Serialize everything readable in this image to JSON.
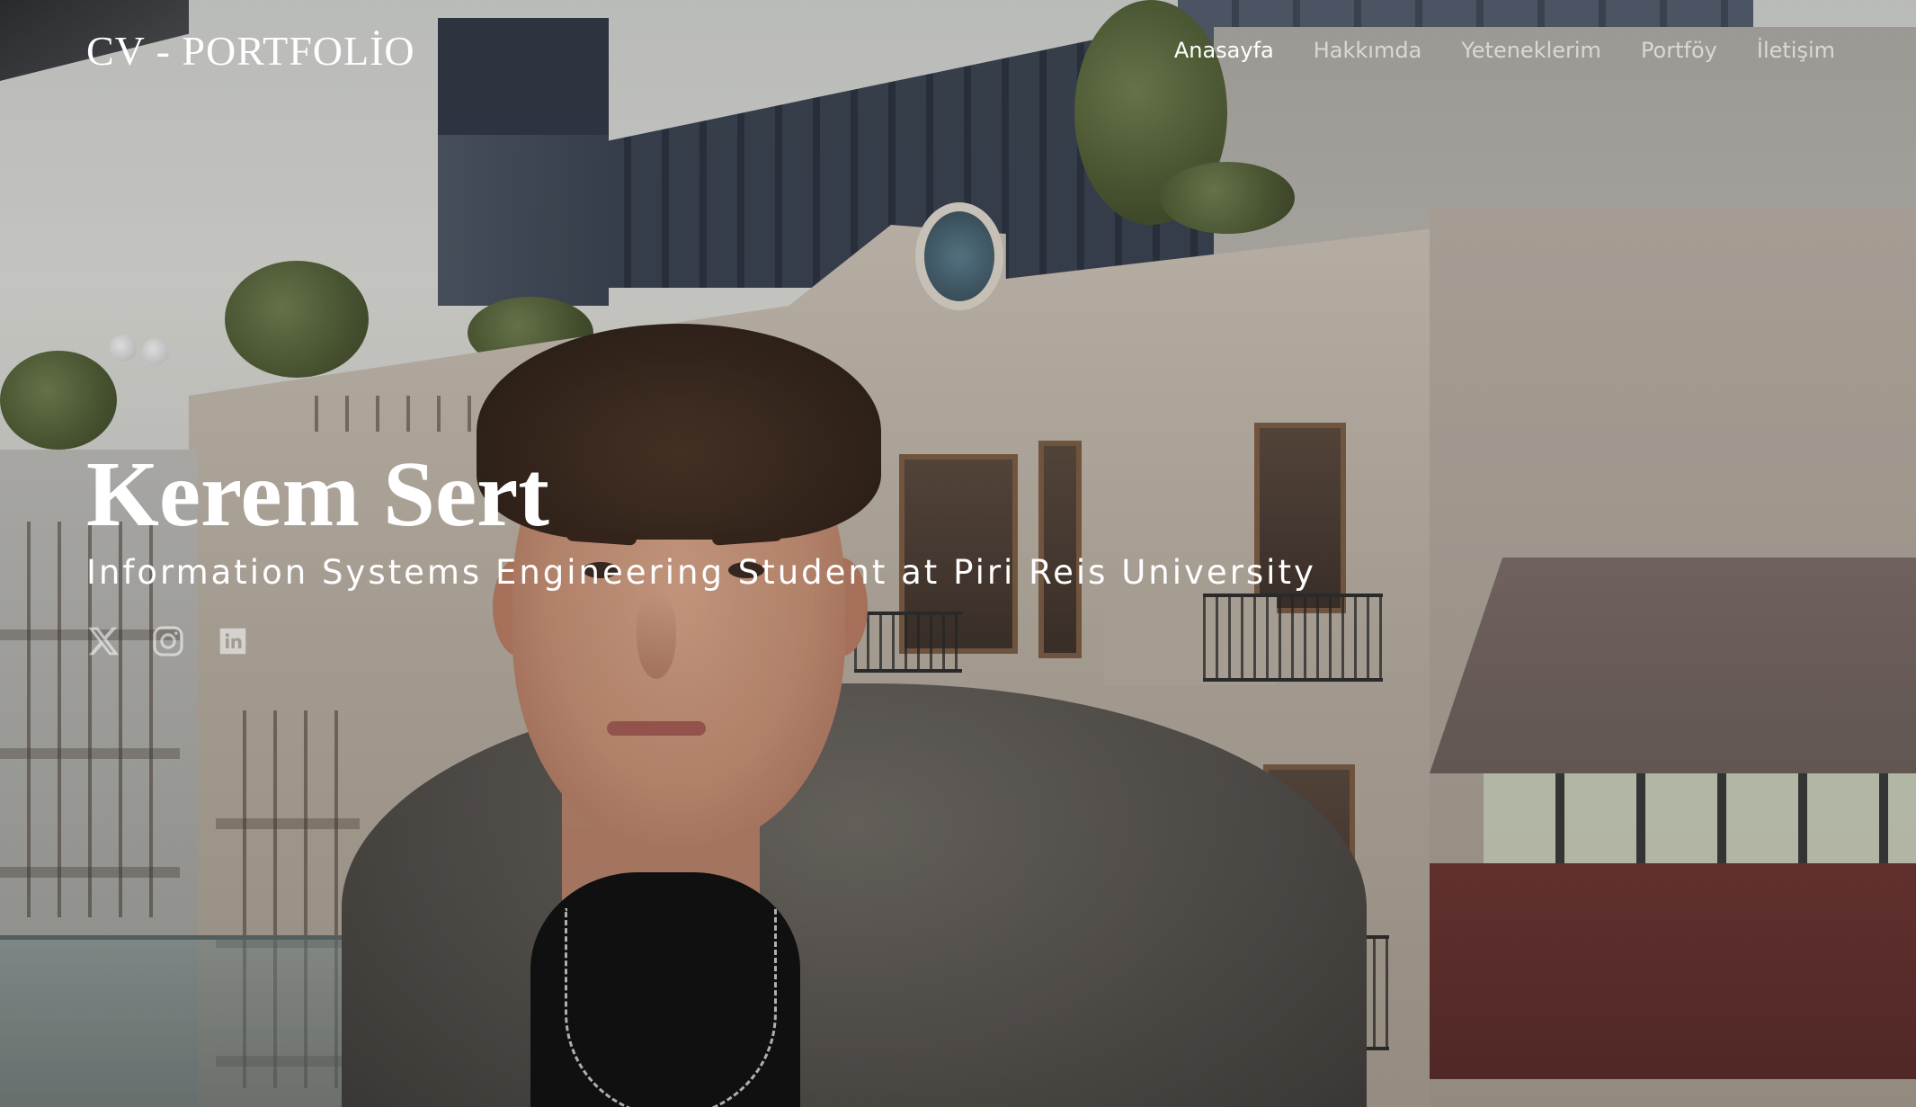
{
  "header": {
    "logo": "CV - PORTFOLİO",
    "nav": [
      {
        "label": "Anasayfa",
        "active": true
      },
      {
        "label": "Hakkımda",
        "active": false
      },
      {
        "label": "Yeteneklerim",
        "active": false
      },
      {
        "label": "Portföy",
        "active": false
      },
      {
        "label": "İletişim",
        "active": false
      }
    ]
  },
  "hero": {
    "name": "Kerem Sert",
    "subtitle": "Information Systems Engineering Student at Piri Reis University",
    "social": [
      {
        "icon": "x-twitter-icon"
      },
      {
        "icon": "instagram-icon"
      },
      {
        "icon": "linkedin-icon"
      }
    ]
  },
  "colors": {
    "text": "#ffffff",
    "nav_inactive": "rgba(255,255,255,0.62)",
    "social_icon": "rgba(255,255,255,0.55)"
  }
}
